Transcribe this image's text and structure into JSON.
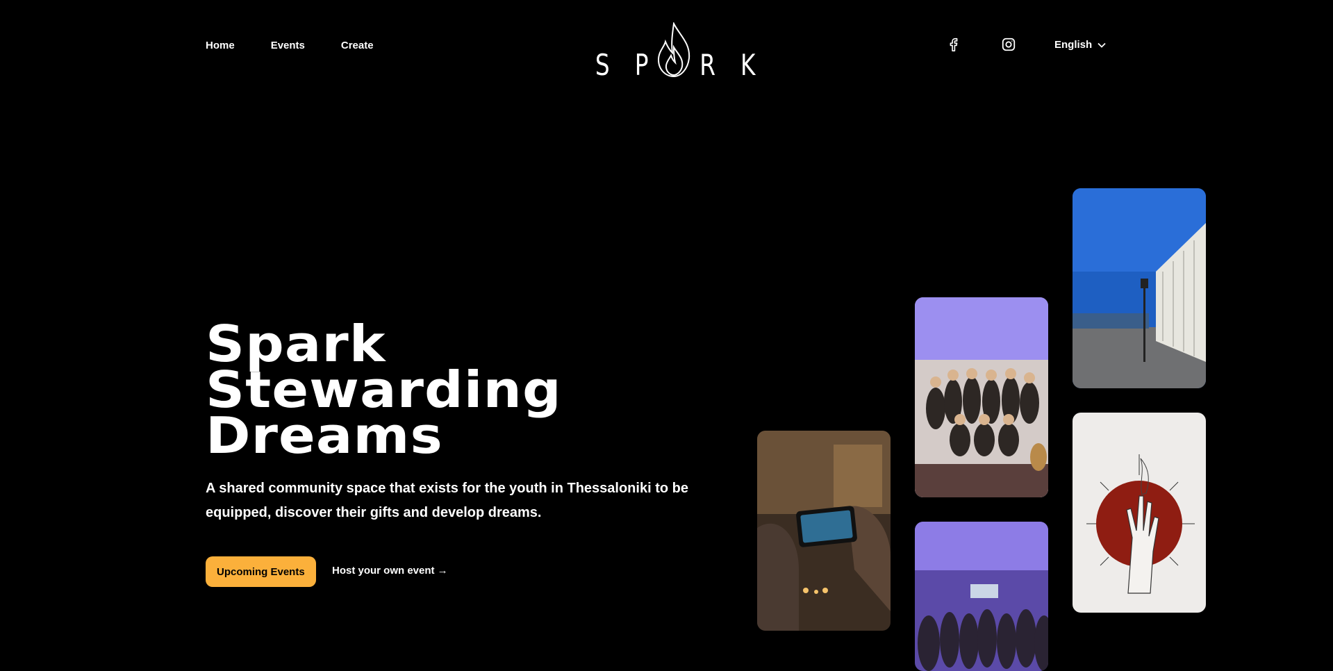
{
  "nav": {
    "items": [
      {
        "label": "Home"
      },
      {
        "label": "Events"
      },
      {
        "label": "Create"
      }
    ]
  },
  "logo": {
    "letters": [
      "S",
      "P",
      "R",
      "K"
    ],
    "icon": "flame-icon"
  },
  "social": {
    "facebook_icon": "facebook-icon",
    "instagram_icon": "instagram-icon"
  },
  "language": {
    "selected": "English",
    "icon": "chevron-down-icon"
  },
  "hero": {
    "title_lines": [
      "Spark",
      "Stewarding",
      "Dreams"
    ],
    "description": "A shared community space that exists for the youth in Thessaloniki to be equipped, discover their gifts and develop dreams.",
    "primary_button": "Upcoming Events",
    "secondary_link": "Host your own event →"
  },
  "colors": {
    "background": "#000000",
    "text": "#FFFFFF",
    "accent": "#FBB03B"
  }
}
